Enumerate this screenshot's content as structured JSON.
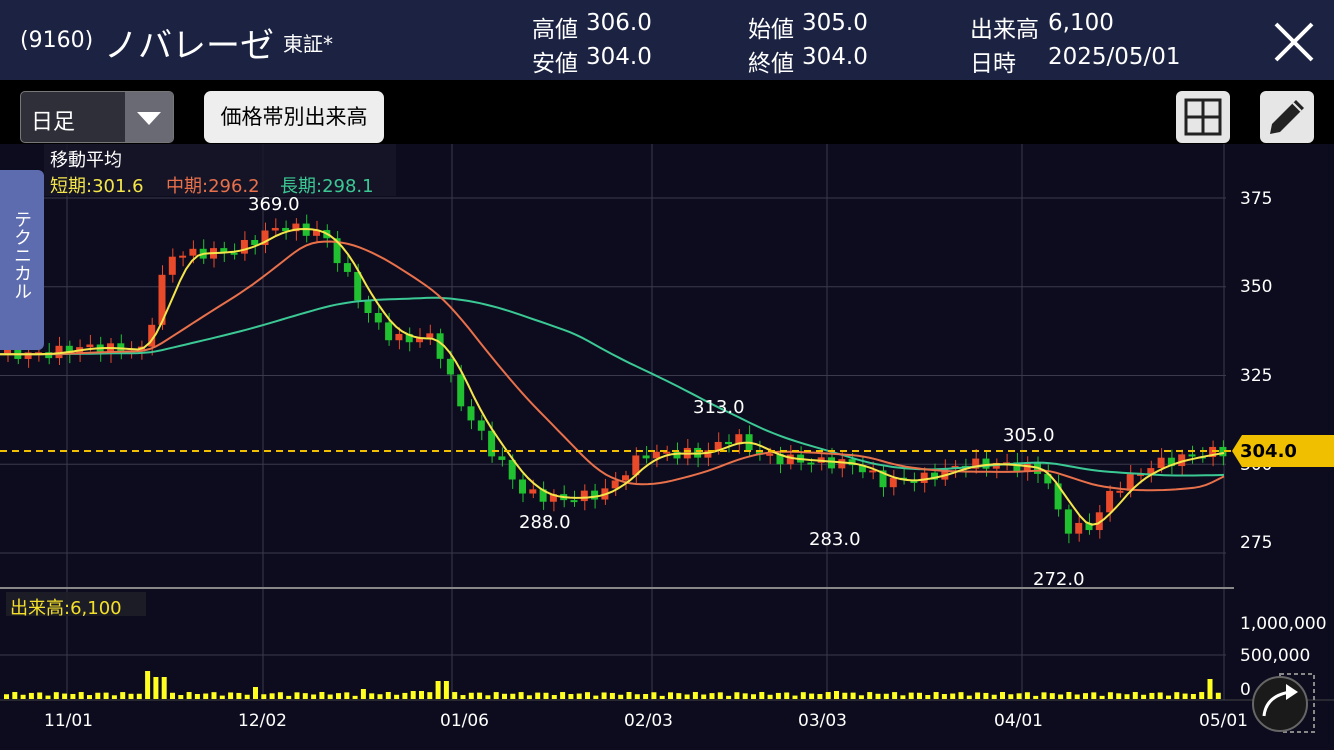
{
  "header": {
    "code": "(9160)",
    "name": "ノバレーゼ",
    "market": "東証*",
    "high_label": "高値",
    "high_value": "306.0",
    "low_label": "安値",
    "low_value": "304.0",
    "open_label": "始値",
    "open_value": "305.0",
    "close_label": "終値",
    "close_value": "304.0",
    "volume_label": "出来高",
    "volume_value": "6,100",
    "date_label": "日時",
    "date_value": "2025/05/01"
  },
  "toolbar": {
    "period_select": "日足",
    "volume_by_price_button": "価格帯別出来高"
  },
  "side_tab": {
    "label": "テクニカル"
  },
  "moving_average": {
    "title": "移動平均",
    "short": "短期:301.6",
    "mid": "中期:296.2",
    "long": "長期:298.1",
    "colors": {
      "short": "#f4e64a",
      "mid": "#e8704a",
      "long": "#3cc894"
    }
  },
  "volume_panel": {
    "label": "出来高:6,100",
    "y_ticks": [
      "1,000,000",
      "500,000",
      "0"
    ]
  },
  "price_tag": "304.0",
  "colors": {
    "up": "#e84a2a",
    "down": "#20c030",
    "volume": "#ffff22",
    "accent": "#f0c000"
  },
  "chart_data": {
    "type": "candlestick",
    "y_ticks": [
      "375",
      "350",
      "325",
      "300",
      "275"
    ],
    "ylim": [
      262,
      380
    ],
    "x_ticks": [
      "11/01",
      "12/02",
      "01/06",
      "02/03",
      "03/03",
      "04/01",
      "05/01"
    ],
    "annotations": [
      "369.0",
      "288.0",
      "313.0",
      "283.0",
      "305.0",
      "272.0"
    ],
    "current_price": 304.0,
    "last_candle": {
      "date": "2025/05/01",
      "open": 305.0,
      "high": 306.0,
      "low": 304.0,
      "close": 304.0,
      "volume": 6100
    }
  },
  "icons": {
    "close": "close-icon",
    "grid": "grid-icon",
    "pencil": "pencil-icon",
    "share": "share-icon",
    "dropdown": "chevron-down-icon"
  }
}
